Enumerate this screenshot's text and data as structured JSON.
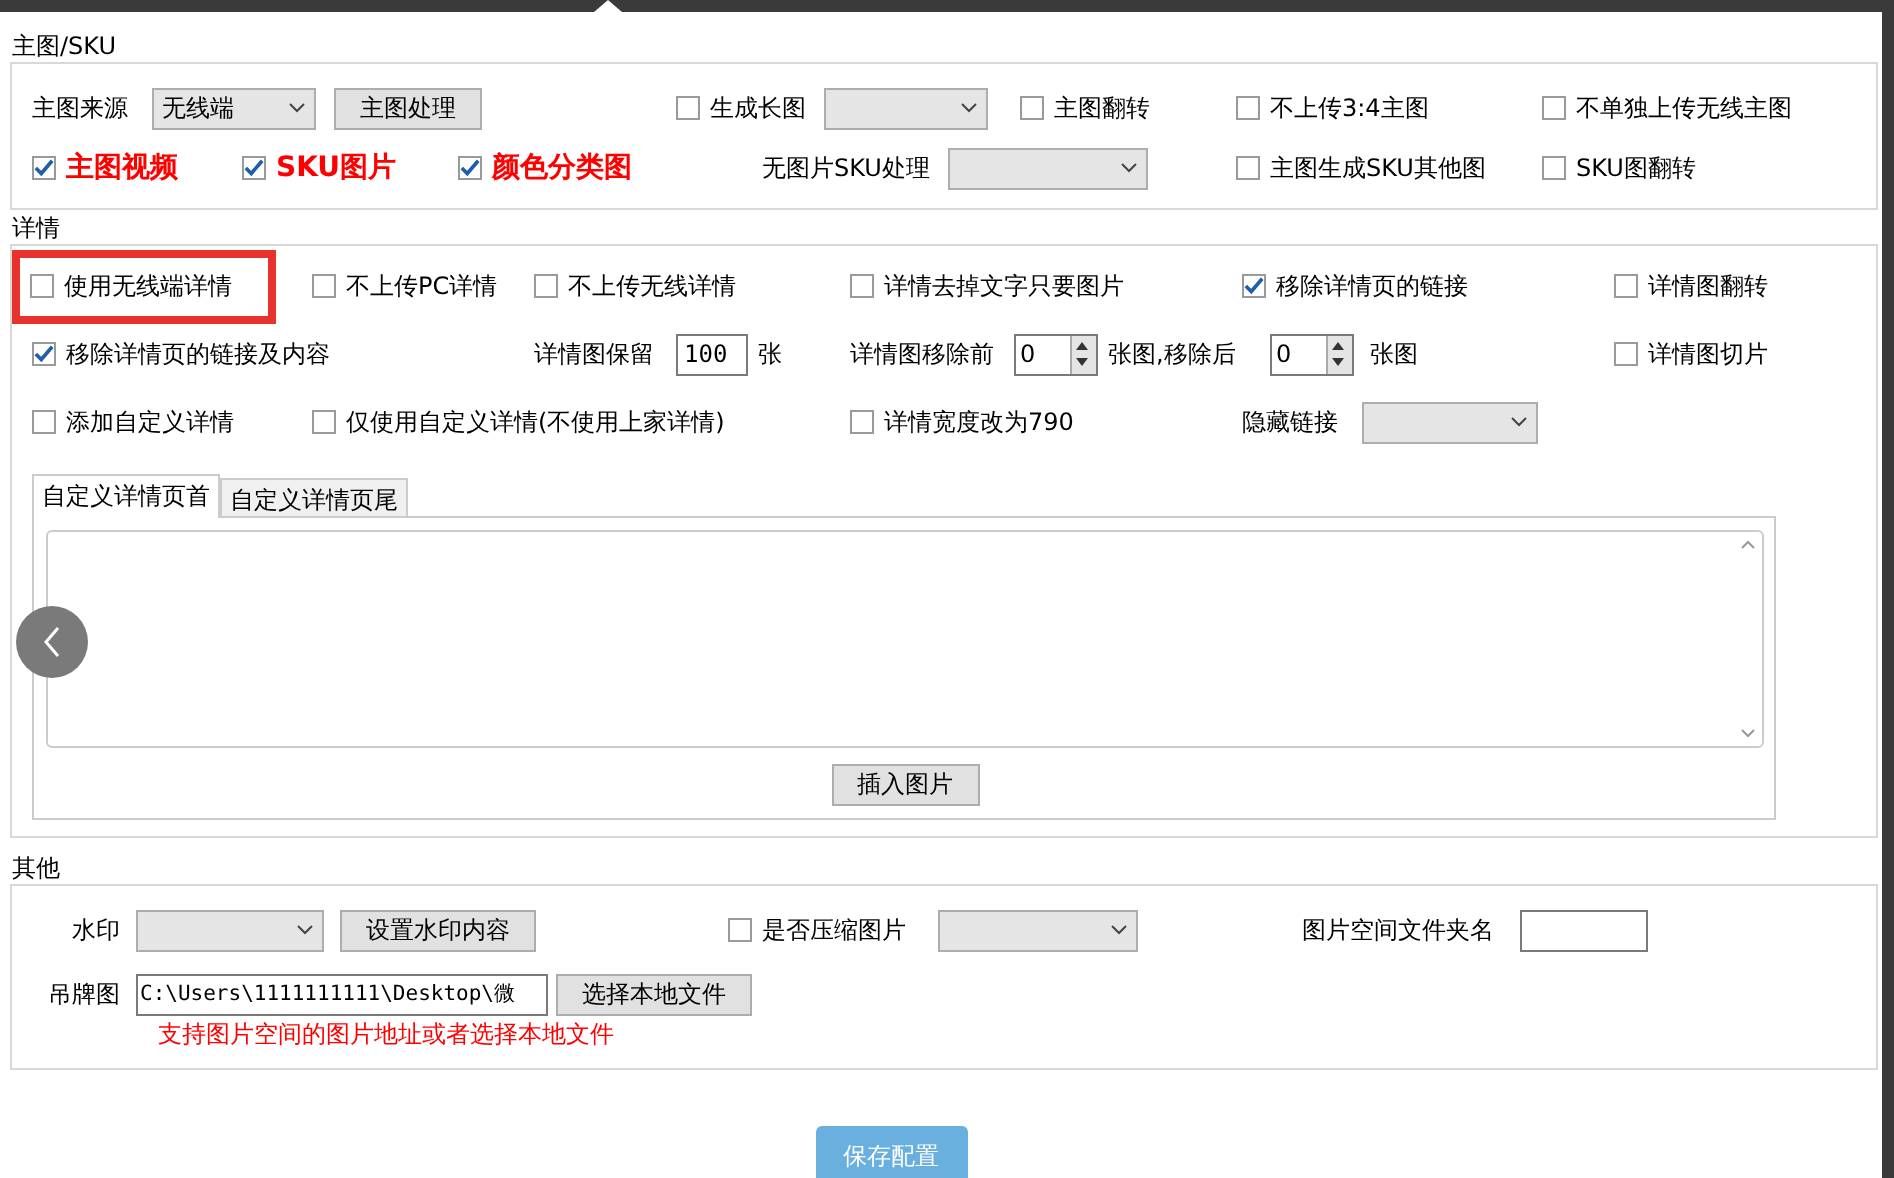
{
  "main_sku": {
    "title": "主图/SKU",
    "rows": [
      {
        "items": [
          {
            "kind": "label",
            "text": "主图来源"
          },
          {
            "kind": "select",
            "value": "无线端"
          },
          {
            "kind": "button",
            "text": "主图处理"
          },
          {
            "kind": "checkbox",
            "text": "生成长图",
            "checked": false
          },
          {
            "kind": "select"
          },
          {
            "kind": "checkbox",
            "text": "主图翻转",
            "checked": false
          },
          {
            "kind": "checkbox",
            "text": "不上传3:4主图",
            "checked": false
          },
          {
            "kind": "checkbox",
            "text": "不单独上传无线主图",
            "checked": false
          }
        ]
      },
      {
        "items": [
          {
            "kind": "checkbox",
            "text": "主图视频",
            "checked": true,
            "emphasis": true
          },
          {
            "kind": "checkbox",
            "text": "SKU图片",
            "checked": true,
            "emphasis": true
          },
          {
            "kind": "checkbox",
            "text": "颜色分类图",
            "checked": true,
            "emphasis": true
          },
          {
            "kind": "label",
            "text": "无图片SKU处理"
          },
          {
            "kind": "select"
          },
          {
            "kind": "checkbox",
            "text": "主图生成SKU其他图",
            "checked": false,
            "emphasis": false
          },
          {
            "kind": "checkbox",
            "text": "SKU图翻转",
            "checked": false,
            "emphasis": false
          }
        ]
      }
    ]
  },
  "detail": {
    "title": "详情",
    "rows": [
      {
        "items": [
          {
            "kind": "checkbox",
            "text": "使用无线端详情",
            "checked": false,
            "highlighted": true
          },
          {
            "kind": "checkbox",
            "text": "不上传PC详情",
            "checked": false
          },
          {
            "kind": "checkbox",
            "text": "不上传无线详情",
            "checked": false
          },
          {
            "kind": "checkbox",
            "text": "详情去掉文字只要图片",
            "checked": false
          },
          {
            "kind": "checkbox",
            "text": "移除详情页的链接",
            "checked": true
          },
          {
            "kind": "checkbox",
            "text": "详情图翻转",
            "checked": false
          }
        ]
      },
      {
        "items": [
          {
            "kind": "checkbox",
            "text": "移除详情页的链接及内容",
            "checked": true
          },
          {
            "kind": "label",
            "text": "详情图保留"
          },
          {
            "kind": "input",
            "value": "100"
          },
          {
            "kind": "label",
            "text": "张"
          },
          {
            "kind": "label",
            "text": "详情图移除前"
          },
          {
            "kind": "spin",
            "value": "0"
          },
          {
            "kind": "label",
            "text": "张图,移除后"
          },
          {
            "kind": "spin",
            "value": "0"
          },
          {
            "kind": "label",
            "text": "张图"
          },
          {
            "kind": "checkbox",
            "text": "详情图切片",
            "checked": false
          }
        ]
      },
      {
        "items": [
          {
            "kind": "checkbox",
            "text": "添加自定义详情",
            "checked": false
          },
          {
            "kind": "checkbox",
            "text": "仅使用自定义详情(不使用上家详情)",
            "checked": false
          },
          {
            "kind": "checkbox",
            "text": "详情宽度改为790",
            "checked": false
          },
          {
            "kind": "label",
            "text": "隐藏链接"
          },
          {
            "kind": "select"
          }
        ]
      }
    ],
    "tabs": [
      {
        "label": "自定义详情页首",
        "selected": true
      },
      {
        "label": "自定义详情页尾",
        "selected": false
      }
    ],
    "insert_button": "插入图片"
  },
  "other": {
    "title": "其他",
    "rows": [
      {
        "items": [
          {
            "kind": "label",
            "text": "水印"
          },
          {
            "kind": "select"
          },
          {
            "kind": "button",
            "text": "设置水印内容"
          },
          {
            "kind": "checkbox",
            "text": "是否压缩图片",
            "checked": false
          },
          {
            "kind": "select"
          },
          {
            "kind": "label",
            "text": "图片空间文件夹名"
          },
          {
            "kind": "input"
          }
        ]
      },
      {
        "items": [
          {
            "kind": "label",
            "text": "吊牌图"
          },
          {
            "kind": "input",
            "value": "C:\\Users\\1111111111\\Desktop\\微"
          },
          {
            "kind": "button",
            "text": "选择本地文件"
          }
        ]
      }
    ],
    "note": "支持图片空间的图片地址或者选择本地文件"
  },
  "save_button": "保存配置"
}
